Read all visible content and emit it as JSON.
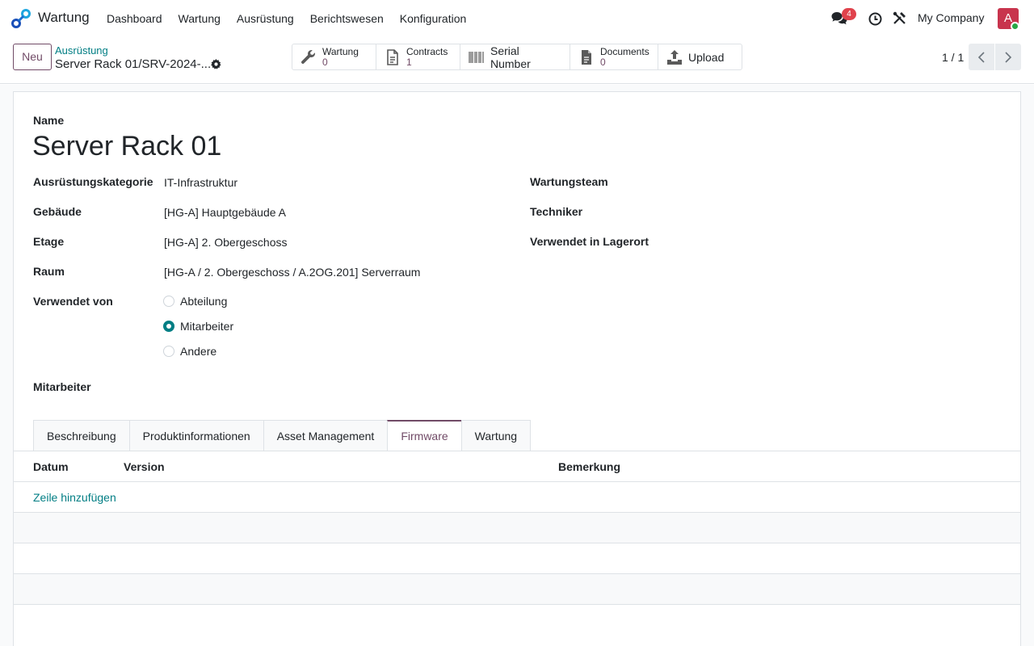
{
  "navbar": {
    "app_name": "Wartung",
    "menu": [
      "Dashboard",
      "Wartung",
      "Ausrüstung",
      "Berichtswesen",
      "Konfiguration"
    ],
    "chat_badge": "4",
    "company": "My Company",
    "avatar_letter": "A"
  },
  "control": {
    "new_label": "Neu",
    "breadcrumb": "Ausrüstung",
    "record_title": "Server Rack 01/SRV-2024-...",
    "smart_buttons": [
      {
        "label": "Wartung",
        "count": "0",
        "icon": "wrench-icon"
      },
      {
        "label": "Contracts",
        "count": "1",
        "icon": "document-icon"
      },
      {
        "label": "Serial Number",
        "icon": "barcode-icon"
      },
      {
        "label": "Documents",
        "count": "0",
        "icon": "file-icon"
      },
      {
        "label": "Upload",
        "icon": "upload-icon"
      }
    ],
    "pager": "1 / 1"
  },
  "form": {
    "name_label": "Name",
    "name_value": "Server Rack 01",
    "fields_left": [
      {
        "label": "Ausrüstungskategorie",
        "value": "IT-Infrastruktur"
      },
      {
        "label": "Gebäude",
        "value": "[HG-A] Hauptgebäude A"
      },
      {
        "label": "Etage",
        "value": "[HG-A] 2. Obergeschoss"
      },
      {
        "label": "Raum",
        "value": "[HG-A / 2. Obergeschoss / A.2OG.201] Serverraum"
      }
    ],
    "fields_right": [
      {
        "label": "Wartungsteam",
        "value": ""
      },
      {
        "label": "Techniker",
        "value": ""
      },
      {
        "label": "Verwendet in Lagerort",
        "value": ""
      }
    ],
    "used_by_label": "Verwendet von",
    "used_by_options": [
      "Abteilung",
      "Mitarbeiter",
      "Andere"
    ],
    "used_by_selected": "Mitarbeiter",
    "employee_label": "Mitarbeiter"
  },
  "tabs": [
    "Beschreibung",
    "Produktinformationen",
    "Asset Management",
    "Firmware",
    "Wartung"
  ],
  "active_tab": "Firmware",
  "firmware_table": {
    "columns": [
      "Datum",
      "Version",
      "Bemerkung"
    ],
    "add_line": "Zeile hinzufügen"
  },
  "colors": {
    "primary": "#714b67",
    "link": "#017e84",
    "badge": "#e0424c",
    "avatar": "#c8344d"
  }
}
